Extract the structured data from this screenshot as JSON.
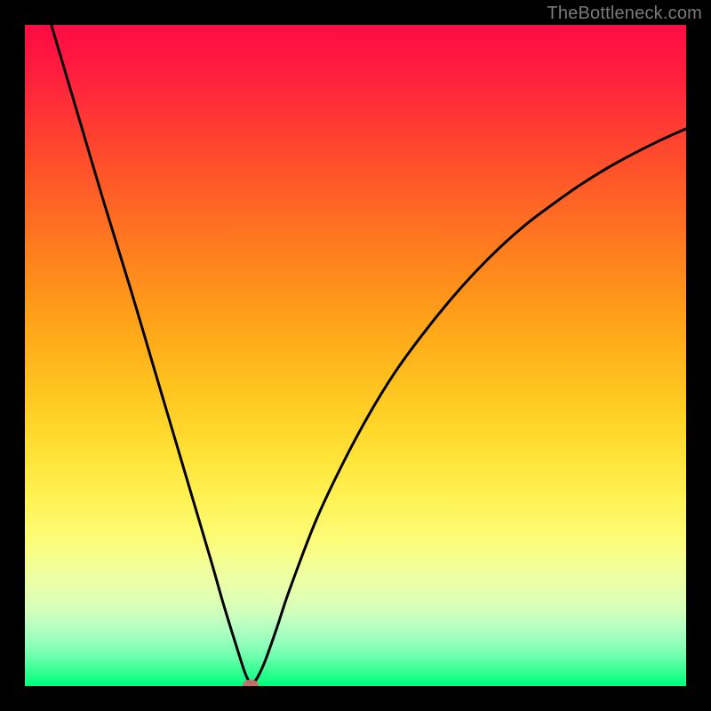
{
  "watermark": "TheBottleneck.com",
  "colors": {
    "frame": "#000000",
    "curve": "#000000",
    "dot": "#cc6d6d"
  },
  "chart_data": {
    "type": "line",
    "title": "",
    "xlabel": "",
    "ylabel": "",
    "xlim": [
      0,
      100
    ],
    "ylim": [
      0,
      100
    ],
    "grid": false,
    "legend": false,
    "series": [
      {
        "name": "curve",
        "x": [
          4,
          8,
          12,
          16,
          20,
          24,
          28,
          30,
          32,
          33.5,
          34.5,
          36,
          38,
          40,
          44,
          48,
          52,
          56,
          60,
          64,
          68,
          72,
          76,
          80,
          84,
          88,
          92,
          96,
          100
        ],
        "y": [
          100,
          86.5,
          73,
          60,
          46.5,
          33,
          19.5,
          12.5,
          6,
          1.5,
          0.5,
          3,
          8.5,
          14.5,
          25,
          33.5,
          41,
          47.5,
          53,
          58,
          62.5,
          66.5,
          70,
          73,
          75.8,
          78.3,
          80.5,
          82.5,
          84.3
        ]
      }
    ],
    "marker": {
      "x": 34.2,
      "y": 0.2
    }
  }
}
